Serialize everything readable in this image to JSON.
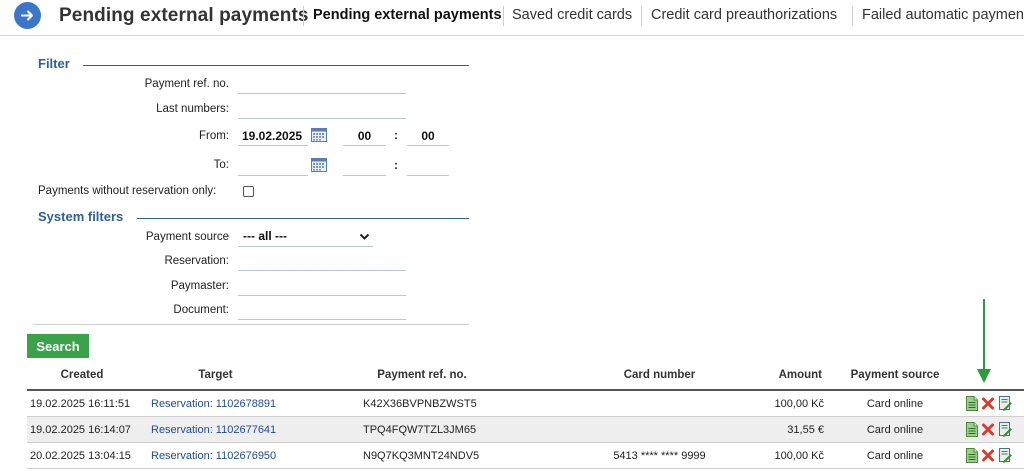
{
  "header": {
    "title": "Pending external payments",
    "tabs": [
      {
        "label": "Pending external payments",
        "active": true
      },
      {
        "label": "Saved credit cards",
        "active": false
      },
      {
        "label": "Credit card preauthorizations",
        "active": false
      },
      {
        "label": "Failed automatic payments",
        "active": false
      }
    ]
  },
  "filter": {
    "section_title": "Filter",
    "payment_ref_label": "Payment ref. no.",
    "payment_ref_value": "",
    "last_numbers_label": "Last numbers:",
    "last_numbers_value": "",
    "from_label": "From:",
    "from_date": "19.02.2025",
    "from_hour": "00",
    "from_minute": "00",
    "to_label": "To:",
    "to_date": "",
    "to_hour": "",
    "to_minute": "",
    "time_separator": ":",
    "without_reservation_label": "Payments without reservation only:",
    "without_reservation_checked": false
  },
  "system_filters": {
    "section_title": "System filters",
    "payment_source_label": "Payment source",
    "payment_source_value": "--- all ---",
    "reservation_label": "Reservation:",
    "reservation_value": "",
    "paymaster_label": "Paymaster:",
    "paymaster_value": "",
    "document_label": "Document:",
    "document_value": ""
  },
  "search_button": "Search",
  "table": {
    "columns": [
      "Created",
      "Target",
      "Payment ref. no.",
      "Card number",
      "Amount",
      "Payment source"
    ],
    "rows": [
      {
        "created": "19.02.2025 16:11:51",
        "target": "Reservation: 1102678891",
        "ref": "K42X36BVPNBZWST5",
        "card": "",
        "amount": "100,00 Kč",
        "source": "Card online"
      },
      {
        "created": "19.02.2025 16:14:07",
        "target": "Reservation: 1102677641",
        "ref": "TPQ4FQW7TZL3JM65",
        "card": "",
        "amount": "31,55 €",
        "source": "Card online"
      },
      {
        "created": "20.02.2025 13:04:15",
        "target": "Reservation: 1102676950",
        "ref": "N9Q7KQ3MNT24NDV5",
        "card": "5413 **** **** 9999",
        "amount": "100,00 Kč",
        "source": "Card online"
      }
    ],
    "row_actions": [
      "document-icon",
      "delete-icon",
      "edit-document-icon"
    ]
  },
  "colors": {
    "accent_blue": "#3b76c9",
    "section_blue": "#2e5f9c",
    "link_blue": "#1f4b99",
    "search_green": "#3aa34a",
    "arrow_green": "#2e9a3e",
    "delete_red": "#d93b2b"
  }
}
